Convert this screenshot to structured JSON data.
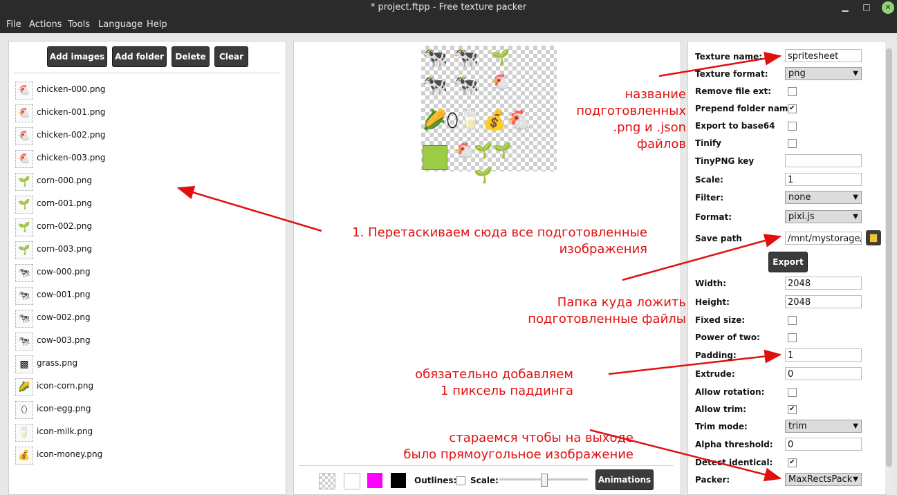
{
  "window": {
    "title": "* project.ftpp - Free texture packer"
  },
  "menu": [
    "File",
    "Actions",
    "Tools",
    "Language",
    "Help"
  ],
  "toolbar": {
    "add_images": "Add images",
    "add_folder": "Add folder",
    "delete": "Delete",
    "clear": "Clear"
  },
  "files": [
    {
      "name": "chicken-000.png",
      "icon": "🐔"
    },
    {
      "name": "chicken-001.png",
      "icon": "🐔"
    },
    {
      "name": "chicken-002.png",
      "icon": "🐔"
    },
    {
      "name": "chicken-003.png",
      "icon": "🐔"
    },
    {
      "name": "corn-000.png",
      "icon": "🌱"
    },
    {
      "name": "corn-001.png",
      "icon": "🌱"
    },
    {
      "name": "corn-002.png",
      "icon": "🌱"
    },
    {
      "name": "corn-003.png",
      "icon": "🌱"
    },
    {
      "name": "cow-000.png",
      "icon": "🐄"
    },
    {
      "name": "cow-001.png",
      "icon": "🐄"
    },
    {
      "name": "cow-002.png",
      "icon": "🐄"
    },
    {
      "name": "cow-003.png",
      "icon": "🐄"
    },
    {
      "name": "grass.png",
      "icon": "▩"
    },
    {
      "name": "icon-corn.png",
      "icon": "🌽"
    },
    {
      "name": "icon-egg.png",
      "icon": "⬯"
    },
    {
      "name": "icon-milk.png",
      "icon": "🥛"
    },
    {
      "name": "icon-money.png",
      "icon": "💰"
    }
  ],
  "preview_bar": {
    "outlines_label": "Outlines:",
    "scale_label": "Scale:",
    "animations_button": "Animations",
    "scale_level": 0.5
  },
  "settings": {
    "texture_name_label": "Texture name:",
    "texture_name_value": "spritesheet",
    "texture_format_label": "Texture format:",
    "texture_format_value": "png",
    "remove_ext_label": "Remove file ext:",
    "prepend_folder_label": "Prepend folder name:",
    "export_base64_label": "Export to base64",
    "tinify_label": "Tinify",
    "tinypng_key_label": "TinyPNG key",
    "tinypng_key_value": "",
    "scale_label": "Scale:",
    "scale_value": "1",
    "filter_label": "Filter:",
    "filter_value": "none",
    "format_label": "Format:",
    "format_value": "pixi.js",
    "save_path_label": "Save path",
    "save_path_value": "/mnt/mystorage/js",
    "export_button": "Export",
    "width_label": "Width:",
    "width_value": "2048",
    "height_label": "Height:",
    "height_value": "2048",
    "fixed_size_label": "Fixed size:",
    "power_of_two_label": "Power of two:",
    "padding_label": "Padding:",
    "padding_value": "1",
    "extrude_label": "Extrude:",
    "extrude_value": "0",
    "allow_rotation_label": "Allow rotation:",
    "allow_trim_label": "Allow trim:",
    "trim_mode_label": "Trim mode:",
    "trim_mode_value": "trim",
    "alpha_threshold_label": "Alpha threshold:",
    "alpha_threshold_value": "0",
    "detect_identical_label": "Detect identical:",
    "packer_label": "Packer:",
    "packer_value": "MaxRectsPack"
  },
  "checkboxes": {
    "remove_ext": false,
    "prepend_folder": true,
    "export_base64": false,
    "tinify": false,
    "fixed_size": false,
    "power_of_two": false,
    "allow_rotation": false,
    "allow_trim": true,
    "detect_identical": true,
    "outlines": false
  },
  "annotations": {
    "texture_name_line1": "название",
    "texture_name_line2": "подготовленных",
    "texture_name_line3": ".png и .json",
    "texture_name_line4": "файлов",
    "drag_line1": "1. Перетаскиваем сюда все подготовленные",
    "drag_line2": "изображения",
    "folder_line1": "Папка куда ложить",
    "folder_line2": "подготовленные файлы",
    "padding_line1": "обязательно добавляем",
    "padding_line2": "1 пиксель паддинга",
    "packer_line1": "стараемся чтобы на выходе",
    "packer_line2": "было прямоугольное изображение"
  },
  "colors": {
    "annotation": "#e01010",
    "titlebar": "#2b2b2b",
    "close_button": "#8fd37a",
    "bg_magenta": "#ff00ff"
  }
}
